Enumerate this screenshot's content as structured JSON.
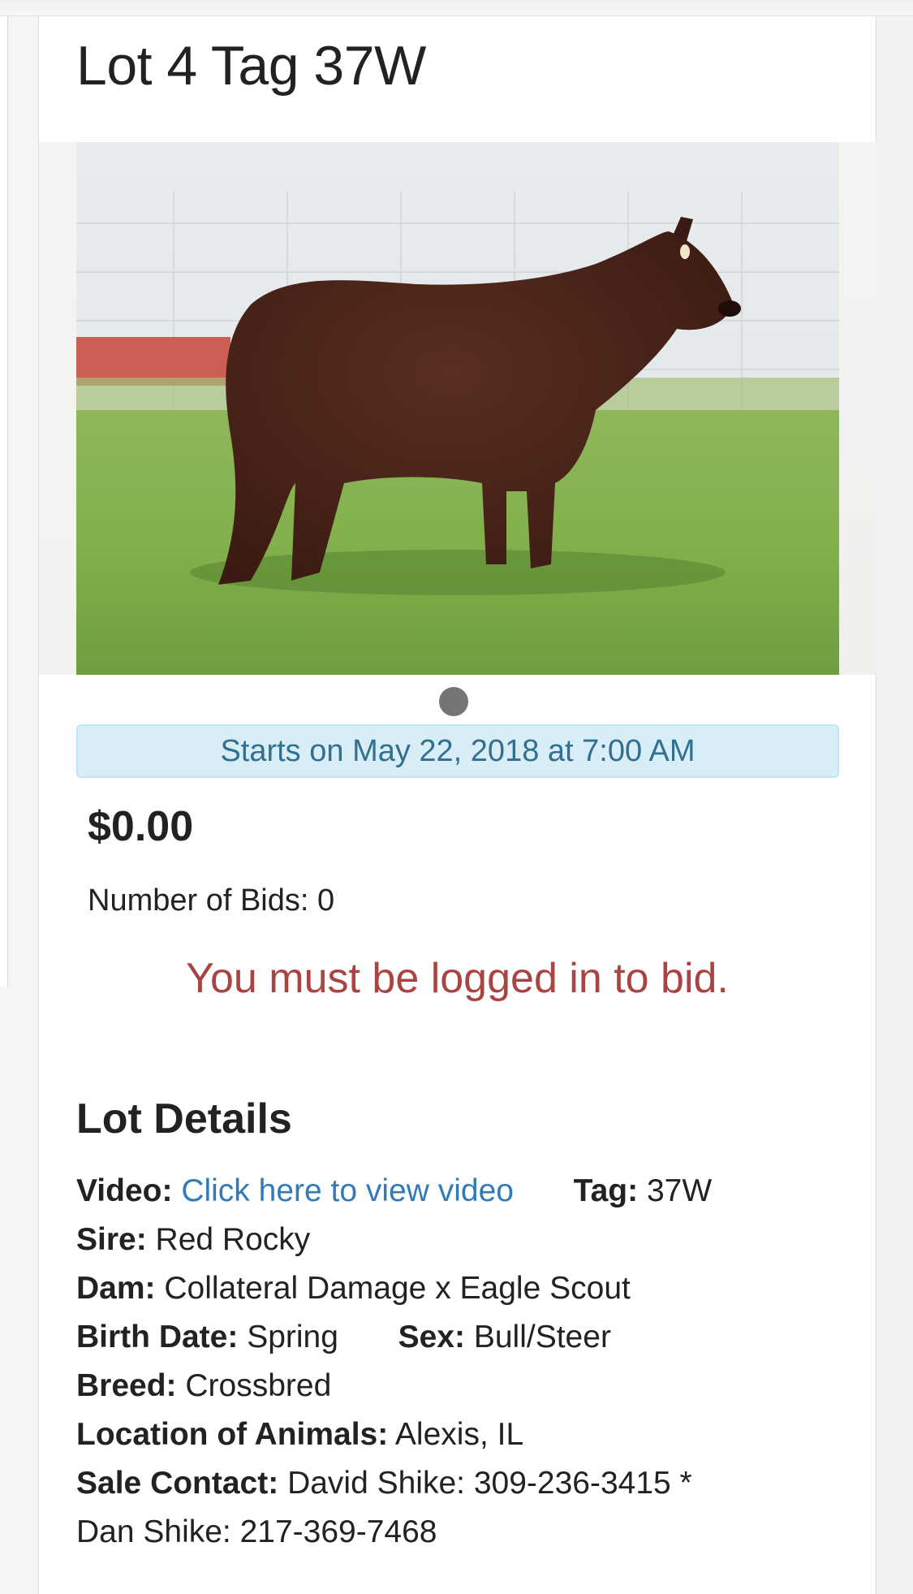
{
  "lot": {
    "title": "Lot 4 Tag 37W",
    "start_notice": "Starts on May 22, 2018 at 7:00 AM",
    "price": "$0.00",
    "bids_label": "Number of Bids:",
    "bids_count": "0",
    "login_warning": "You must be logged in to bid."
  },
  "details": {
    "heading": "Lot Details",
    "video_label": "Video:",
    "video_link": "Click here to view video",
    "tag_label": "Tag:",
    "tag_value": "37W",
    "sire_label": "Sire:",
    "sire_value": "Red Rocky",
    "dam_label": "Dam:",
    "dam_value": "Collateral Damage x Eagle Scout",
    "birth_label": "Birth Date:",
    "birth_value": "Spring",
    "sex_label": "Sex:",
    "sex_value": "Bull/Steer",
    "breed_label": "Breed:",
    "breed_value": "Crossbred",
    "location_label": "Location of Animals:",
    "location_value": "Alexis, IL",
    "contact_label": "Sale Contact:",
    "contact_value": "David Shike: 309-236-3415 *",
    "contact_value_2": "Dan Shike: 217-369-7468"
  },
  "colors": {
    "info_bg": "#d9edf7",
    "info_text": "#31708f",
    "warning_text": "#a94442",
    "link": "#337ab7"
  },
  "carousel": {
    "slide_count": 1,
    "active_index": 0
  },
  "icons": {
    "carousel_indicator": "dot"
  }
}
